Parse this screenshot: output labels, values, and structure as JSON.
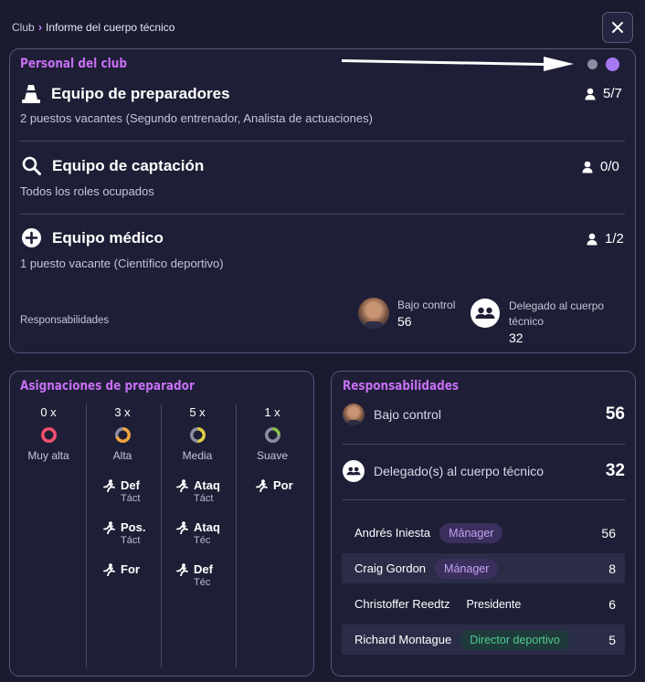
{
  "breadcrumb": {
    "root": "Club",
    "current": "Informe del cuerpo técnico"
  },
  "close_icon": "close-icon",
  "personal": {
    "title": "Personal del club",
    "pager": {
      "count": 2,
      "active_index": 1,
      "active_color": "#a678f2",
      "inactive_color": "#8c8e9e"
    },
    "rows": [
      {
        "title": "Equipo de preparadores",
        "subtitle": "2 puestos vacantes (Segundo entrenador, Analista de actuaciones)",
        "count": "5/7",
        "icon": "cone-icon"
      },
      {
        "title": "Equipo de captación",
        "subtitle": "Todos los roles ocupados",
        "count": "0/0",
        "icon": "magnifier-icon"
      },
      {
        "title": "Equipo médico",
        "subtitle": "1 puesto vacante (Científico deportivo)",
        "count": "1/2",
        "icon": "plus-circle-icon"
      }
    ],
    "responsibilities_label": "Responsabilidades",
    "under_control": {
      "label": "Bajo control",
      "value": "56"
    },
    "delegated": {
      "label": "Delegado al cuerpo técnico",
      "value": "32"
    }
  },
  "assignments": {
    "title": "Asignaciones de preparador",
    "levels": [
      {
        "count": "0 x",
        "label": "Muy alta",
        "color": "#f0506e",
        "fill": 0
      },
      {
        "count": "3 x",
        "label": "Alta",
        "color": "#f0a53c",
        "fill": 0.7
      },
      {
        "count": "5 x",
        "label": "Media",
        "color": "#e0d040",
        "fill": 0.5
      },
      {
        "count": "1 x",
        "label": "Suave",
        "color": "#8ac04a",
        "fill": 0.25
      }
    ],
    "positions": {
      "alta": [
        {
          "label": "Def",
          "sub": "Táct"
        },
        {
          "label": "Pos.",
          "sub": "Táct"
        },
        {
          "label": "For",
          "sub": ""
        }
      ],
      "media": [
        {
          "label": "Ataq",
          "sub": "Táct"
        },
        {
          "label": "Ataq",
          "sub": "Téc"
        },
        {
          "label": "Def",
          "sub": "Téc"
        }
      ],
      "suave": [
        {
          "label": "Por",
          "sub": ""
        }
      ]
    }
  },
  "responsibilities": {
    "title": "Responsabilidades",
    "under_control": {
      "label": "Bajo control",
      "value": "56"
    },
    "delegated": {
      "label": "Delegado(s) al cuerpo técnico",
      "value": "32"
    },
    "people": [
      {
        "name": "Andrés Iniesta",
        "role": "Mánager",
        "style": "purple",
        "value": "56"
      },
      {
        "name": "Craig Gordon",
        "role": "Mánager",
        "style": "purple",
        "value": "8"
      },
      {
        "name": "Christoffer Reedtz",
        "role": "Presidente",
        "style": "plain",
        "value": "6"
      },
      {
        "name": "Richard Montague",
        "role": "Director deportivo",
        "style": "green",
        "value": "5"
      }
    ]
  }
}
